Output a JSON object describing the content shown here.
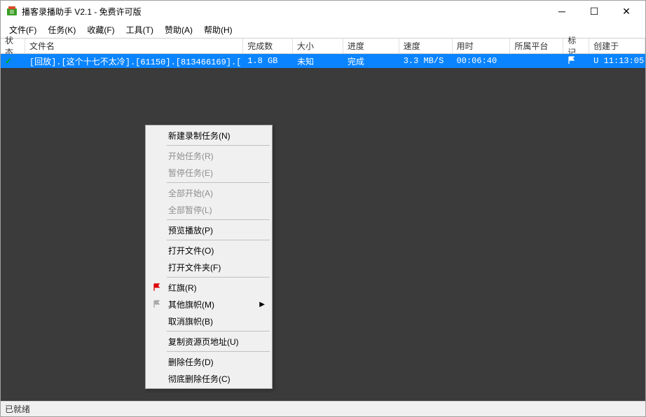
{
  "window": {
    "title": "播客录播助手 V2.1 - 免费许可版"
  },
  "menubar": {
    "file": "文件(F)",
    "tasks": "任务(K)",
    "favorites": "收藏(F)",
    "tools": "工具(T)",
    "sponsor": "赞助(A)",
    "help": "帮助(H)"
  },
  "columns": {
    "status": "状态",
    "filename": "文件名",
    "done": "完成数",
    "size": "大小",
    "progress": "进度",
    "speed": "速度",
    "time": "用时",
    "platform": "所属平台",
    "mark": "标记",
    "created": "创建于"
  },
  "row": {
    "filename": "[回放].[这个十七不太冷].[61150].[813466169].[...",
    "done": "1.8 GB",
    "size": "未知",
    "progress": "完成",
    "speed": "3.3 MB/S",
    "time": "00:06:40",
    "platform": "",
    "created": "U 11:13:05"
  },
  "context_menu": {
    "new_task": "新建录制任务(N)",
    "start_task": "开始任务(R)",
    "pause_task": "暂停任务(E)",
    "start_all": "全部开始(A)",
    "pause_all": "全部暂停(L)",
    "preview": "预览播放(P)",
    "open_file": "打开文件(O)",
    "open_folder": "打开文件夹(F)",
    "red_flag": "红旗(R)",
    "other_flags": "其他旗帜(M)",
    "cancel_flag": "取消旗帜(B)",
    "copy_url": "复制资源页地址(U)",
    "delete_task": "删除任务(D)",
    "delete_forever": "彻底删除任务(C)"
  },
  "status_text": "已就绪"
}
